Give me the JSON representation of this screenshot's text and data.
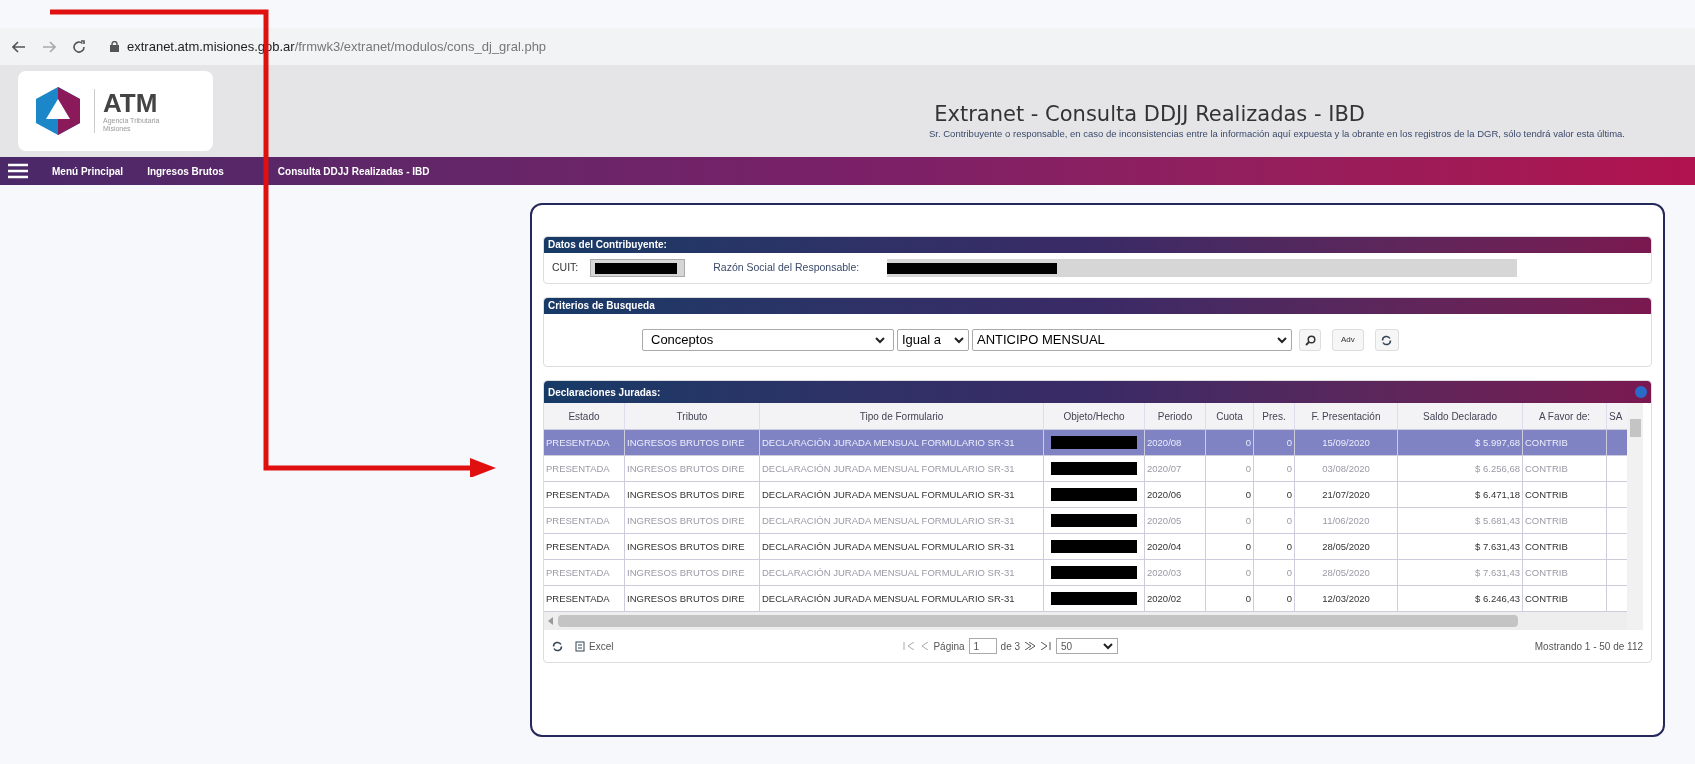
{
  "browser": {
    "url_host": "extranet.atm.misiones.gob.ar",
    "url_path": "/frmwk3/extranet/modulos/cons_dj_gral.php"
  },
  "header": {
    "logo_name": "ATM",
    "logo_subtitle": "Agencia Tributaria Misiones",
    "title": "Extranet - Consulta DDJJ Realizadas - IBD",
    "notice": "Sr. Contribuyente o responsable, en caso de inconsistencias entre la información aquí expuesta y la obrante en los registros de la DGR, sólo tendrá valor esta última."
  },
  "nav": {
    "items": [
      "Menú Principal",
      "Ingresos Brutos",
      "Consulta DDJJ Realizadas - IBD"
    ]
  },
  "taxpayer": {
    "title": "Datos del Contribuyente:",
    "cuit_label": "CUIT:",
    "name_label": "Razón Social del Responsable:"
  },
  "search": {
    "title": "Criterios de Busqueda",
    "field": "Conceptos",
    "operator": "Igual a",
    "value": "ANTICIPO MENSUAL",
    "advanced_button": "Adv"
  },
  "declarations": {
    "title": "Declaraciones Juradas:",
    "columns": [
      {
        "label": "Estado",
        "kind": "text"
      },
      {
        "label": "Tributo",
        "kind": "text"
      },
      {
        "label": "Tipo de Formulario",
        "kind": "text"
      },
      {
        "label": "Objeto/Hecho",
        "kind": "redacted"
      },
      {
        "label": "Periodo",
        "kind": "text"
      },
      {
        "label": "Cuota",
        "kind": "text"
      },
      {
        "label": "Pres.",
        "kind": "text"
      },
      {
        "label": "F. Presentación",
        "kind": "text"
      },
      {
        "label": "Saldo Declarado",
        "kind": "text"
      },
      {
        "label": "A Favor de:",
        "kind": "text"
      },
      {
        "label": "SA",
        "kind": "cut"
      }
    ],
    "rows": [
      {
        "selected": true,
        "faded": false,
        "cells": [
          "PRESENTADA",
          "INGRESOS BRUTOS DIRE",
          "DECLARACIÓN JURADA MENSUAL FORMULARIO SR-31",
          "",
          "2020/08",
          "0",
          "0",
          "15/09/2020",
          "$ 5.997,68",
          "CONTRIB"
        ]
      },
      {
        "selected": false,
        "faded": true,
        "cells": [
          "PRESENTADA",
          "INGRESOS BRUTOS DIRE",
          "DECLARACIÓN JURADA MENSUAL FORMULARIO SR-31",
          "",
          "2020/07",
          "0",
          "0",
          "03/08/2020",
          "$ 6.256,68",
          "CONTRIB"
        ]
      },
      {
        "selected": false,
        "faded": false,
        "cells": [
          "PRESENTADA",
          "INGRESOS BRUTOS DIRE",
          "DECLARACIÓN JURADA MENSUAL FORMULARIO SR-31",
          "",
          "2020/06",
          "0",
          "0",
          "21/07/2020",
          "$ 6.471,18",
          "CONTRIB"
        ]
      },
      {
        "selected": false,
        "faded": true,
        "cells": [
          "PRESENTADA",
          "INGRESOS BRUTOS DIRE",
          "DECLARACIÓN JURADA MENSUAL FORMULARIO SR-31",
          "",
          "2020/05",
          "0",
          "0",
          "11/06/2020",
          "$ 5.681,43",
          "CONTRIB"
        ]
      },
      {
        "selected": false,
        "faded": false,
        "cells": [
          "PRESENTADA",
          "INGRESOS BRUTOS DIRE",
          "DECLARACIÓN JURADA MENSUAL FORMULARIO SR-31",
          "",
          "2020/04",
          "0",
          "0",
          "28/05/2020",
          "$ 7.631,43",
          "CONTRIB"
        ]
      },
      {
        "selected": false,
        "faded": true,
        "cells": [
          "PRESENTADA",
          "INGRESOS BRUTOS DIRE",
          "DECLARACIÓN JURADA MENSUAL FORMULARIO SR-31",
          "",
          "2020/03",
          "0",
          "0",
          "28/05/2020",
          "$ 7.631,43",
          "CONTRIB"
        ]
      },
      {
        "selected": false,
        "faded": false,
        "cells": [
          "PRESENTADA",
          "INGRESOS BRUTOS DIRE",
          "DECLARACIÓN JURADA MENSUAL FORMULARIO SR-31",
          "",
          "2020/02",
          "0",
          "0",
          "12/03/2020",
          "$ 6.246,43",
          "CONTRIB"
        ]
      }
    ]
  },
  "footer": {
    "excel_label": "Excel",
    "page_label": "Página",
    "page_value": "1",
    "page_of": "de 3",
    "page_size": "50",
    "summary": "Mostrando 1 - 50 de 112"
  }
}
